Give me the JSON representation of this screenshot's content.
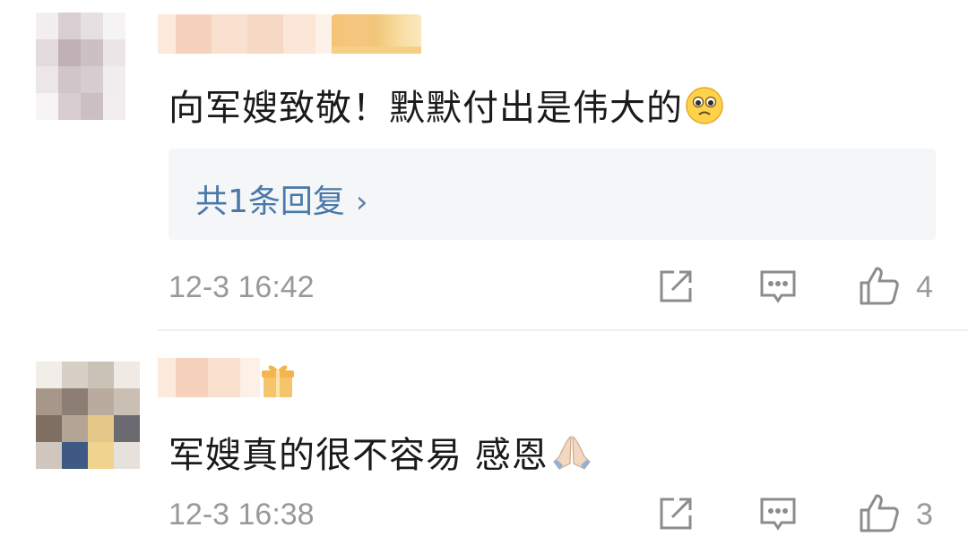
{
  "comments": [
    {
      "text": "向军嫂致敬！默默付出是伟大的",
      "emoji": "pleading-face",
      "reply_link": "共1条回复",
      "time": "12-3 16:42",
      "likes": "4"
    },
    {
      "text": "军嫂真的很不容易 感恩",
      "emoji": "folded-hands",
      "time": "12-3 16:38",
      "likes": "3"
    }
  ],
  "colors": {
    "text": "#1a1a1a",
    "meta": "#999999",
    "link": "#4a78a8",
    "reply_bg": "#f5f6f8"
  }
}
